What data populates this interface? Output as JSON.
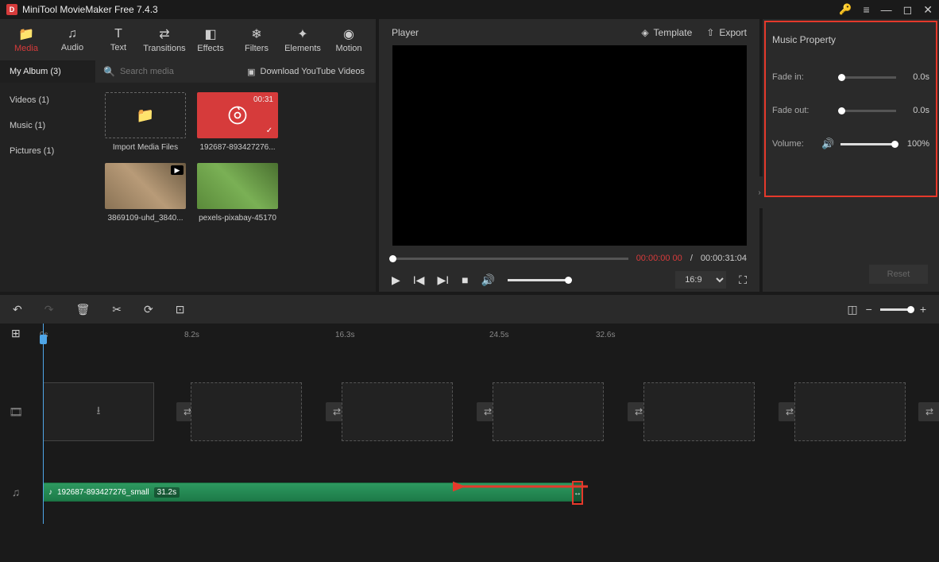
{
  "app": {
    "title": "MiniTool MovieMaker Free 7.4.3"
  },
  "tabs": {
    "media": "Media",
    "audio": "Audio",
    "text": "Text",
    "transitions": "Transitions",
    "effects": "Effects",
    "filters": "Filters",
    "elements": "Elements",
    "motion": "Motion"
  },
  "album": {
    "tab": "My Album (3)",
    "search_ph": "Search media",
    "download": "Download YouTube Videos"
  },
  "sidebar": {
    "videos": "Videos (1)",
    "music": "Music (1)",
    "pictures": "Pictures (1)"
  },
  "media": {
    "import": "Import Media Files",
    "item1_dur": "00:31",
    "item1": "192687-893427276...",
    "item2": "3869109-uhd_3840...",
    "item3": "pexels-pixabay-45170"
  },
  "preview": {
    "title": "Player",
    "template": "Template",
    "export": "Export",
    "cur": "00:00:00 00",
    "sep": " / ",
    "total": "00:00:31:04",
    "aspect": "16:9"
  },
  "props": {
    "title": "Music Property",
    "fadein_l": "Fade in:",
    "fadein_v": "0.0s",
    "fadeout_l": "Fade out:",
    "fadeout_v": "0.0s",
    "volume_l": "Volume:",
    "volume_v": "100%",
    "reset": "Reset"
  },
  "ruler": {
    "t0": "0s",
    "t1": "8.2s",
    "t2": "16.3s",
    "t3": "24.5s",
    "t4": "32.6s"
  },
  "audio_clip": {
    "name": "192687-893427276_small",
    "dur": "31.2s"
  }
}
